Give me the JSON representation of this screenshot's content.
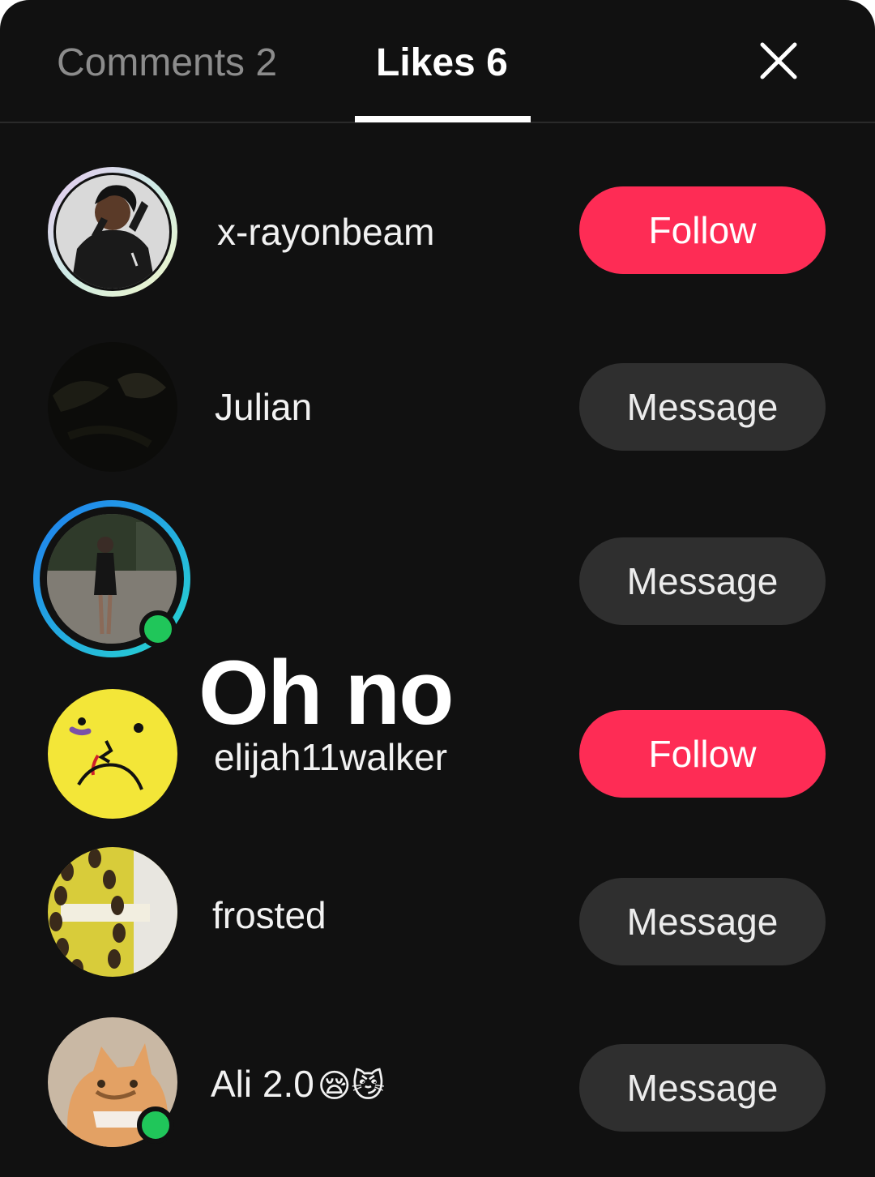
{
  "tabs": {
    "comments_label": "Comments 2",
    "likes_label": "Likes 6"
  },
  "overlay": {
    "text": "Oh no"
  },
  "users": [
    {
      "username": "x-rayonbeam",
      "button": "Follow",
      "button_type": "follow",
      "online": false
    },
    {
      "username": "Julian",
      "button": "Message",
      "button_type": "message",
      "online": false
    },
    {
      "username": "",
      "button": "Message",
      "button_type": "message",
      "online": true
    },
    {
      "username": "elijah11walker",
      "button": "Follow",
      "button_type": "follow",
      "online": false
    },
    {
      "username": "frosted",
      "button": "Message",
      "button_type": "message",
      "online": false
    },
    {
      "username": "Ali 2.0",
      "username_emojis": "😪😼",
      "button": "Message",
      "button_type": "message",
      "online": true
    }
  ],
  "colors": {
    "background": "#111111",
    "follow": "#fe2c55",
    "message": "#2f2f2f",
    "online": "#20c65a"
  }
}
